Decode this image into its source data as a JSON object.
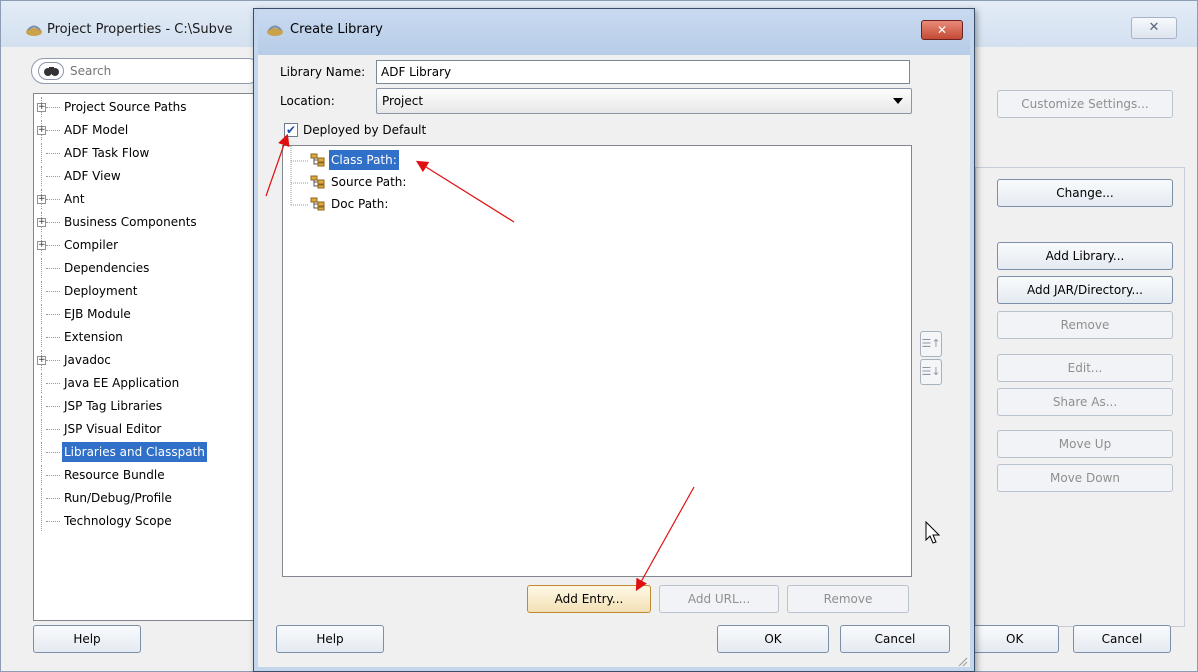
{
  "background_dialog": {
    "title": "Project Properties - C:\\Subve",
    "close_glyph": "✕",
    "search_placeholder": "Search",
    "nav_items": [
      {
        "label": "Project Source Paths",
        "expandable": true
      },
      {
        "label": "ADF Model",
        "expandable": true
      },
      {
        "label": "ADF Task Flow",
        "expandable": false
      },
      {
        "label": "ADF View",
        "expandable": false
      },
      {
        "label": "Ant",
        "expandable": true
      },
      {
        "label": "Business Components",
        "expandable": true
      },
      {
        "label": "Compiler",
        "expandable": true
      },
      {
        "label": "Dependencies",
        "expandable": false
      },
      {
        "label": "Deployment",
        "expandable": false
      },
      {
        "label": "EJB Module",
        "expandable": false
      },
      {
        "label": "Extension",
        "expandable": false
      },
      {
        "label": "Javadoc",
        "expandable": true
      },
      {
        "label": "Java EE Application",
        "expandable": false
      },
      {
        "label": "JSP Tag Libraries",
        "expandable": false
      },
      {
        "label": "JSP Visual Editor",
        "expandable": false
      },
      {
        "label": "Libraries and Classpath",
        "expandable": false,
        "selected": true
      },
      {
        "label": "Resource Bundle",
        "expandable": false
      },
      {
        "label": "Run/Debug/Profile",
        "expandable": false
      },
      {
        "label": "Technology Scope",
        "expandable": false
      }
    ],
    "buttons": {
      "customize_settings": "Customize Settings...",
      "change": "Change...",
      "add_library": "Add Library...",
      "add_jar_directory": "Add JAR/Directory...",
      "remove": "Remove",
      "edit": "Edit...",
      "share_as": "Share As...",
      "move_up": "Move Up",
      "move_down": "Move Down",
      "help": "Help",
      "ok": "OK",
      "cancel": "Cancel"
    }
  },
  "create_library_dialog": {
    "title": "Create Library",
    "close_glyph": "✕",
    "library_name_label": "Library Name:",
    "library_name_value": "ADF Library",
    "location_label": "Location:",
    "location_value": "Project",
    "deployed_by_default_label": "Deployed by Default",
    "deployed_by_default_checked": true,
    "check_glyph": "✔",
    "tree_nodes": [
      {
        "label": "Class Path:",
        "selected": true
      },
      {
        "label": "Source Path:",
        "selected": false
      },
      {
        "label": "Doc Path:",
        "selected": false
      }
    ],
    "move_up_glyph": "☰↑",
    "move_down_glyph": "☰↓",
    "buttons": {
      "add_entry": "Add Entry...",
      "add_url": "Add URL...",
      "remove": "Remove",
      "help": "Help",
      "ok": "OK",
      "cancel": "Cancel"
    }
  },
  "colors": {
    "selection": "#3170c9",
    "annotation_arrow": "#e01010",
    "close_button_red": "#c34a34"
  }
}
